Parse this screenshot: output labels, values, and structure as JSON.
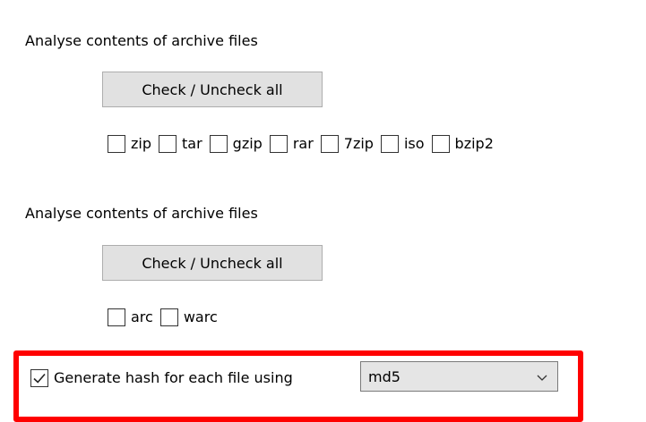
{
  "archives_section": {
    "label": "Analyse contents of archive files",
    "toggle_button": "Check / Uncheck all",
    "formats": [
      {
        "label": "zip",
        "checked": false
      },
      {
        "label": "tar",
        "checked": false
      },
      {
        "label": "gzip",
        "checked": false
      },
      {
        "label": "rar",
        "checked": false
      },
      {
        "label": "7zip",
        "checked": false
      },
      {
        "label": "iso",
        "checked": false
      },
      {
        "label": "bzip2",
        "checked": false
      }
    ]
  },
  "web_archives_section": {
    "label": "Analyse contents of archive files",
    "toggle_button": "Check / Uncheck all",
    "formats": [
      {
        "label": "arc",
        "checked": false
      },
      {
        "label": "warc",
        "checked": false
      }
    ]
  },
  "hash_option": {
    "label": "Generate hash for each file using",
    "checked": true,
    "selected_algorithm": "md5"
  },
  "colors": {
    "highlight": "#ff0000",
    "button_bg": "#e1e1e1",
    "select_bg": "#e5e5e5"
  },
  "icons": {
    "checkbox_checked": "checkmark-icon",
    "dropdown": "chevron-down-icon"
  }
}
